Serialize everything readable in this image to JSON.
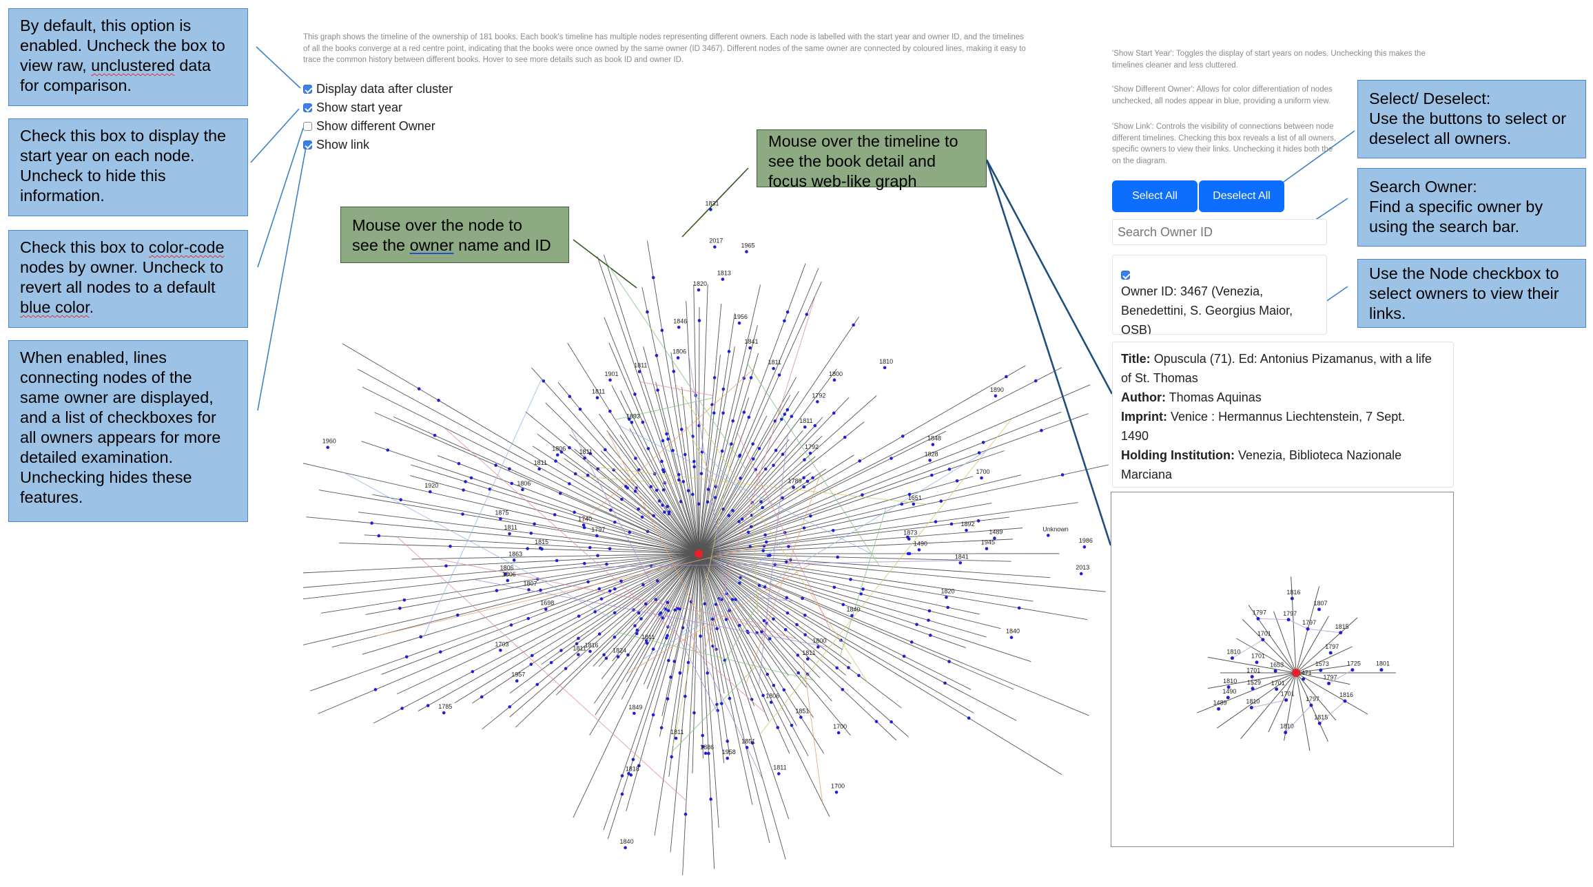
{
  "callouts": {
    "cluster": [
      "By default, this option is",
      "enabled. Uncheck the box to",
      "view raw, ",
      "unclustered",
      " data",
      "for comparison."
    ],
    "start_year": [
      "Check this box to display the",
      "start year on each node.",
      "Uncheck to hide this",
      "information."
    ],
    "diff_owner": [
      "Check this box to ",
      "color-code",
      "nodes by owner. Uncheck to",
      "revert all nodes to a default",
      "blue color",
      "."
    ],
    "show_link": [
      "When enabled, lines",
      "connecting nodes of the",
      "same owner are displayed,",
      "and a list of checkboxes for",
      "all owners appears for more",
      "detailed examination.",
      "Unchecking hides these",
      "features."
    ],
    "node_hover": [
      "Mouse over the node to",
      "see the ",
      "owner",
      " name and ID"
    ],
    "timeline_hover": [
      "Mouse over the timeline to",
      "see the book detail and",
      "focus web-like graph"
    ],
    "select": [
      "Select/ Deselect:",
      "Use the buttons to select or",
      "deselect all owners."
    ],
    "search": [
      "Search Owner:",
      "Find a specific owner by",
      "using the search bar."
    ],
    "node_checkbox": [
      "Use the Node checkbox to",
      "select owners to view their",
      "links."
    ]
  },
  "intro": [
    "This graph shows the timeline of the ownership of 181 books. Each book's timeline has multiple nodes representing different owners. Each node is labelled with the start year and owner ID, and the timelines",
    "of all the books converge at a red centre point, indicating that the books were once owned by the same owner (ID 3467). Different nodes of the same owner are connected by coloured lines, making it easy to",
    "trace the common history between different books. Hover to see more details such as book ID and owner ID."
  ],
  "controls": [
    {
      "label": "Display data after cluster",
      "checked": true
    },
    {
      "label": "Show start year",
      "checked": true
    },
    {
      "label": "Show different Owner",
      "checked": false
    },
    {
      "label": "Show link",
      "checked": true
    }
  ],
  "help": {
    "start_year": [
      "'Show Start Year': Toggles the display of start years on nodes. Unchecking this makes the",
      "timelines cleaner and less cluttered."
    ],
    "diff_owner": [
      "'Show Different Owner': Allows for color differentiation of nodes",
      "unchecked, all nodes appear in blue, providing a uniform view."
    ],
    "show_link": [
      "'Show Link': Controls the visibility of connections between node",
      "different timelines. Checking this box reveals a list of all owners,",
      "specific owners to view their links. Unchecking it hides both the",
      "on the diagram."
    ]
  },
  "buttons": {
    "select_all": "Select All",
    "deselect_all": "Deselect All"
  },
  "search": {
    "placeholder": "Search Owner ID"
  },
  "owner_entry": {
    "checked": true,
    "lines": [
      "Owner ID: 3467 (Venezia,",
      "Benedettini, S. Georgius Maior,",
      "OSB)"
    ]
  },
  "book": {
    "title_label": "Title:",
    "title_lines": [
      "Opuscula (71). Ed: Antonius Pizamanus, with a life",
      "of St. Thomas"
    ],
    "author_label": "Author:",
    "author": "Thomas Aquinas",
    "imprint_label": "Imprint:",
    "imprint_lines": [
      "Venice : Hermannus Liechtenstein, 7 Sept.",
      "1490"
    ],
    "holding_label": "Holding Institution:",
    "holding_lines": [
      "Venezia, Biblioteca Nazionale",
      "Marciana"
    ]
  },
  "colors": {
    "node": "#1f1fd6",
    "centre": "#e8202a",
    "button": "#0d6efd",
    "callout_blue": "#9cc3e6",
    "callout_green": "#8daa82"
  },
  "main_graph_labels": [
    {
      "t": "1960",
      "a": 196,
      "r": 560
    },
    {
      "t": "1920",
      "a": 193,
      "r": 400
    },
    {
      "t": "1875",
      "a": 190,
      "r": 292
    },
    {
      "t": "1811",
      "a": 186,
      "r": 276
    },
    {
      "t": "1815",
      "a": 182,
      "r": 230
    },
    {
      "t": "1863",
      "a": 178,
      "r": 268
    },
    {
      "t": "1806",
      "a": 174,
      "r": 282
    },
    {
      "t": "1806",
      "a": 172,
      "r": 280
    },
    {
      "t": "1807",
      "a": 168,
      "r": 252
    },
    {
      "t": "1698",
      "a": 160,
      "r": 236
    },
    {
      "t": "1703",
      "a": 154,
      "r": 320
    },
    {
      "t": "1957",
      "a": 145,
      "r": 322
    },
    {
      "t": "1785",
      "a": 148,
      "r": 436
    },
    {
      "t": "1811",
      "a": 140,
      "r": 228
    },
    {
      "t": "1816",
      "a": 138,
      "r": 212
    },
    {
      "t": "1824",
      "a": 128,
      "r": 190
    },
    {
      "t": "1811",
      "a": 120,
      "r": 150
    },
    {
      "t": "1840",
      "a": 104,
      "r": 440
    },
    {
      "t": "1818",
      "a": 107,
      "r": 336
    },
    {
      "t": "1849",
      "a": 112,
      "r": 250
    },
    {
      "t": "1811",
      "a": 97,
      "r": 270
    },
    {
      "t": "1886",
      "a": 88,
      "r": 290
    },
    {
      "t": "1958",
      "a": 82,
      "r": 300
    },
    {
      "t": "1851",
      "a": 76,
      "r": 290
    },
    {
      "t": "1806",
      "a": 64,
      "r": 240
    },
    {
      "t": "1851",
      "a": 58,
      "r": 280
    },
    {
      "t": "1811",
      "a": 70,
      "r": 340
    },
    {
      "t": "1700",
      "a": 60,
      "r": 400
    },
    {
      "t": "1700",
      "a": 52,
      "r": 330
    },
    {
      "t": "1811",
      "a": 44,
      "r": 220
    },
    {
      "t": "1800",
      "a": 38,
      "r": 220
    },
    {
      "t": "1840",
      "a": 22,
      "r": 240
    },
    {
      "t": "1840",
      "a": 15,
      "r": 470
    },
    {
      "t": "1820",
      "a": 10,
      "r": 365
    },
    {
      "t": "1986",
      "a": -1,
      "r": 560
    },
    {
      "t": "1945",
      "a": -1,
      "r": 418
    },
    {
      "t": "Unknown",
      "a": -3,
      "r": 508
    },
    {
      "t": "1489",
      "a": -3,
      "r": 430
    },
    {
      "t": "1892",
      "a": -5,
      "r": 390
    },
    {
      "t": "1841",
      "a": 2,
      "r": 380
    },
    {
      "t": "2013",
      "a": 3,
      "r": 556
    },
    {
      "t": "1490",
      "a": -1,
      "r": 320
    },
    {
      "t": "1873",
      "a": -4,
      "r": 306
    },
    {
      "t": "1700",
      "a": -15,
      "r": 425
    },
    {
      "t": "1651",
      "a": -13,
      "r": 320
    },
    {
      "t": "1828",
      "a": -22,
      "r": 362
    },
    {
      "t": "1848",
      "a": -25,
      "r": 375
    },
    {
      "t": "1890",
      "a": -28,
      "r": 488
    },
    {
      "t": "1789",
      "a": -35,
      "r": 168
    },
    {
      "t": "1792",
      "a": -42,
      "r": 218
    },
    {
      "t": "1811",
      "a": -50,
      "r": 240
    },
    {
      "t": "1792",
      "a": -52,
      "r": 280
    },
    {
      "t": "1800",
      "a": -52,
      "r": 320
    },
    {
      "t": "1810",
      "a": -45,
      "r": 382
    },
    {
      "t": "1811",
      "a": -68,
      "r": 290
    },
    {
      "t": "1841",
      "a": -76,
      "r": 308
    },
    {
      "t": "1956",
      "a": -80,
      "r": 340
    },
    {
      "t": "1813",
      "a": -85,
      "r": 400
    },
    {
      "t": "1965",
      "a": -81,
      "r": 444
    },
    {
      "t": "2017",
      "a": -87,
      "r": 446
    },
    {
      "t": "1831",
      "a": -88,
      "r": 500
    },
    {
      "t": "1820",
      "a": -90,
      "r": 383
    },
    {
      "t": "1846",
      "a": -95,
      "r": 330
    },
    {
      "t": "1806",
      "a": -96,
      "r": 286
    },
    {
      "t": "1811",
      "a": -108,
      "r": 278
    },
    {
      "t": "1901",
      "a": -117,
      "r": 283
    },
    {
      "t": "1811",
      "a": -123,
      "r": 270
    },
    {
      "t": "1893",
      "a": -117,
      "r": 214
    },
    {
      "t": "1811",
      "a": -140,
      "r": 216
    },
    {
      "t": "1806",
      "a": -145,
      "r": 250
    },
    {
      "t": "1811",
      "a": -152,
      "r": 262
    },
    {
      "t": "1806",
      "a": -160,
      "r": 272
    },
    {
      "t": "1740",
      "a": -166,
      "r": 172
    },
    {
      "t": "1797",
      "a": -170,
      "r": 150
    }
  ],
  "inset_labels": [
    {
      "t": "1816",
      "a": -93,
      "r": 108
    },
    {
      "t": "1807",
      "a": -70,
      "r": 98
    },
    {
      "t": "1797",
      "a": -125,
      "r": 96
    },
    {
      "t": "1797",
      "a": -98,
      "r": 78
    },
    {
      "t": "1797",
      "a": -75,
      "r": 66
    },
    {
      "t": "1701",
      "a": -135,
      "r": 68
    },
    {
      "t": "1815",
      "a": -42,
      "r": 87
    },
    {
      "t": "1797",
      "a": -30,
      "r": 58
    },
    {
      "t": "1810",
      "a": -167,
      "r": 95
    },
    {
      "t": "1701",
      "a": -165,
      "r": 59
    },
    {
      "t": "1573",
      "a": -6,
      "r": 36
    },
    {
      "t": "1725",
      "a": -3,
      "r": 82
    },
    {
      "t": "1801",
      "a": -2,
      "r": 124
    },
    {
      "t": "1701",
      "a": 175,
      "r": 64
    },
    {
      "t": "1653",
      "a": -175,
      "r": 30
    },
    {
      "t": "1810",
      "a": 168,
      "r": 100
    },
    {
      "t": "1471",
      "a": 40,
      "r": 14
    },
    {
      "t": "1797",
      "a": 18,
      "r": 50
    },
    {
      "t": "1701",
      "a": 140,
      "r": 37
    },
    {
      "t": "1529",
      "a": 160,
      "r": 67
    },
    {
      "t": "1490",
      "a": 160,
      "r": 105
    },
    {
      "t": "1489",
      "a": 155,
      "r": 124
    },
    {
      "t": "1810",
      "a": 142,
      "r": 82
    },
    {
      "t": "1701",
      "a": 110,
      "r": 42
    },
    {
      "t": "1797",
      "a": 65,
      "r": 52
    },
    {
      "t": "1816",
      "a": 30,
      "r": 82
    },
    {
      "t": "1815",
      "a": 65,
      "r": 81
    },
    {
      "t": "1810",
      "a": 100,
      "r": 88
    }
  ]
}
